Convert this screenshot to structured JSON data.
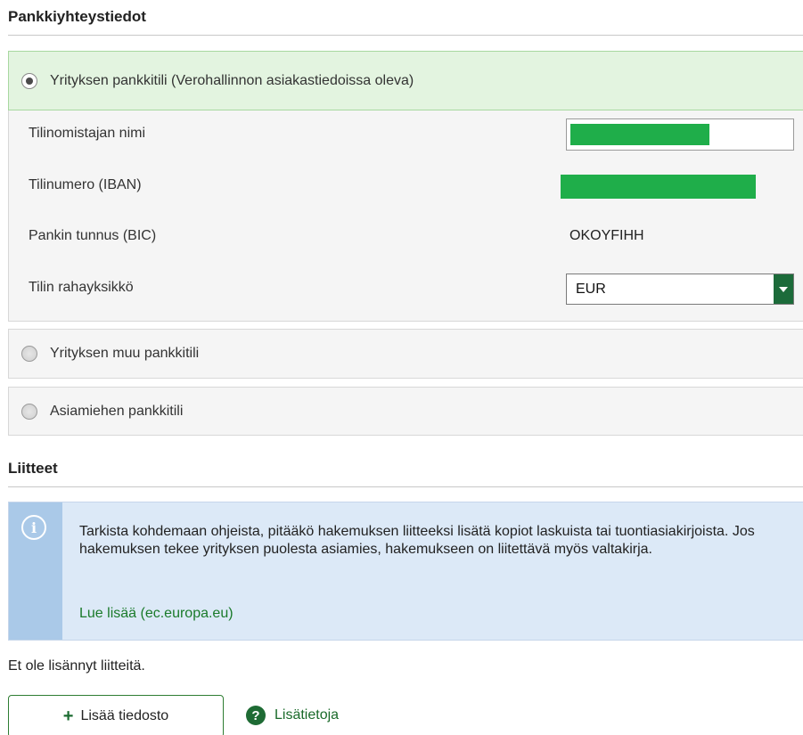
{
  "bank_section": {
    "title": "Pankkiyhteystiedot",
    "options": [
      {
        "label": "Yrityksen pankkitili (Verohallinnon asiakastiedoissa oleva)",
        "selected": true
      },
      {
        "label": "Yrityksen muu pankkitili",
        "selected": false
      },
      {
        "label": "Asiamiehen pankkitili",
        "selected": false
      }
    ],
    "fields": {
      "owner_label": "Tilinomistajan nimi",
      "iban_label": "Tilinumero (IBAN)",
      "bic_label": "Pankin tunnus (BIC)",
      "bic_value": "OKOYFIHH",
      "currency_label": "Tilin rahayksikkö",
      "currency_value": "EUR"
    }
  },
  "attachments_section": {
    "title": "Liitteet",
    "info_text": "Tarkista kohdemaan ohjeista, pitääkö hakemuksen liitteeksi lisätä kopiot laskuista tai tuontiasiakirjoista. Jos hakemuksen tekee yrityksen puolesta asiamies, hakemukseen on liitettävä myös valtakirja.",
    "info_link": "Lue lisää (ec.europa.eu)",
    "no_attachments": "Et ole lisännyt liitteitä.",
    "add_file_button": "Lisää tiedosto",
    "help_link": "Lisätietoja"
  },
  "colors": {
    "selected_bg": "#e3f4e0",
    "accent_green": "#1c6b3a",
    "redaction": "#1fae4a",
    "info_bg": "#dce9f7",
    "info_strip": "#aac9e8"
  },
  "icons": {
    "info": "info-icon",
    "help": "question-icon",
    "add": "plus-icon",
    "dropdown": "chevron-down-icon"
  }
}
